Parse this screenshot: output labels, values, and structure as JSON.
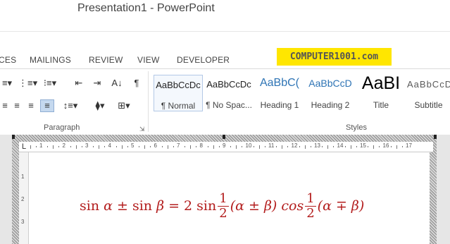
{
  "window": {
    "title": "Presentation1 - PowerPoint"
  },
  "tabs": [
    "CES",
    "MAILINGS",
    "REVIEW",
    "VIEW",
    "DEVELOPER"
  ],
  "badge": "COMPUTER1001.com",
  "ribbon": {
    "paragraph_label": "Paragraph",
    "styles_label": "Styles",
    "styles": [
      {
        "sample": "AaBbCcDc",
        "name": "¶ Normal",
        "selected": true
      },
      {
        "sample": "AaBbCcDc",
        "name": "¶ No Spac...",
        "selected": false
      },
      {
        "sample": "AaBbC(",
        "name": "Heading 1",
        "selected": false
      },
      {
        "sample": "AaBbCcD",
        "name": "Heading 2",
        "selected": false
      },
      {
        "sample": "AaBI",
        "name": "Title",
        "selected": false
      },
      {
        "sample": "AaBbCcD",
        "name": "Subtitle",
        "selected": false
      }
    ],
    "style_colors": {
      "heading": "#2e74b5",
      "title": "#000000",
      "subtitle": "#5a5a5a"
    }
  },
  "ruler": {
    "marks": [
      "1",
      "2",
      "3",
      "4",
      "5",
      "6",
      "7",
      "8",
      "9",
      "10",
      "11",
      "12",
      "13",
      "14",
      "15",
      "16",
      "17"
    ],
    "vertical_marks": [
      "1",
      "2",
      "3"
    ]
  },
  "document": {
    "equation": {
      "lhs_1": "sin ",
      "alpha": "α",
      "pm": " ± sin ",
      "beta": "β",
      "eq": " = 2 sin",
      "frac_num": "1",
      "frac_den": "2",
      "paren_1": "(α ± β) cos",
      "paren_2": "(α ∓ β)"
    },
    "accent_color": "#b31d1d"
  }
}
